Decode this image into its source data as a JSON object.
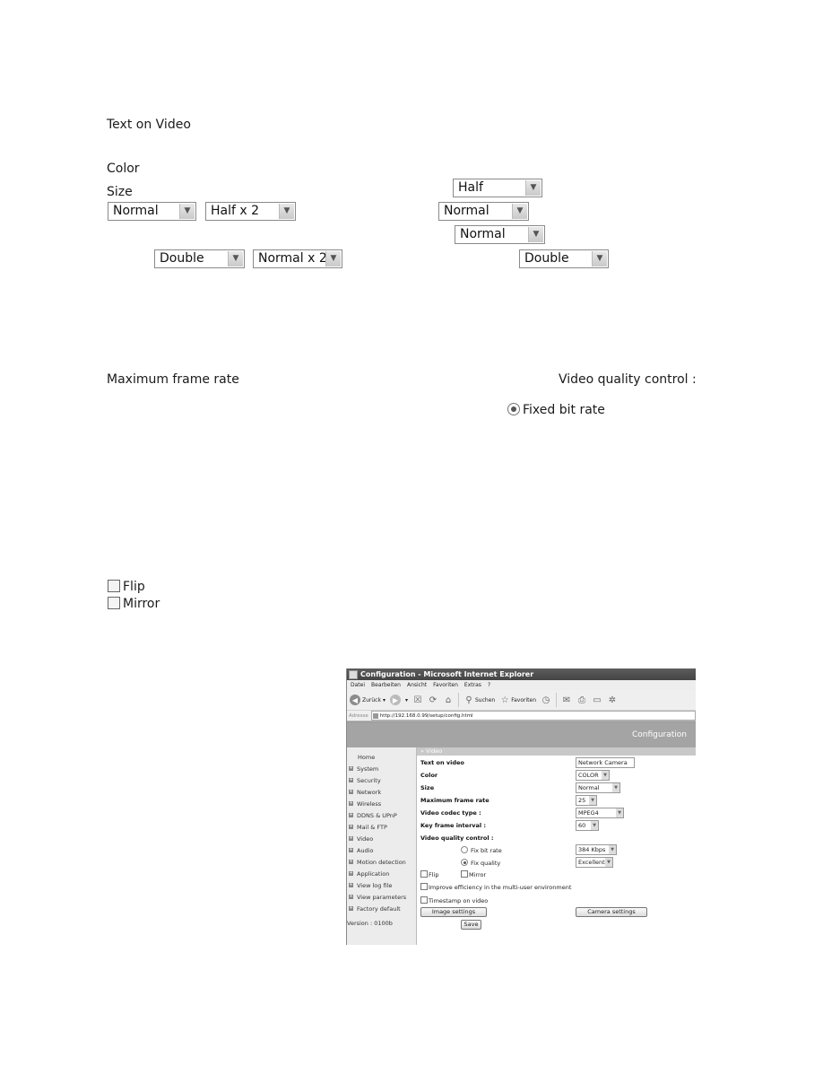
{
  "doc": {
    "text_on_video_label": "Text on Video",
    "color_label": "Color",
    "size_label": "Size",
    "size_dropdowns_left": [
      {
        "value": "Normal"
      },
      {
        "value": "Half x 2"
      },
      {
        "value": "Double"
      },
      {
        "value": "Normal x 2"
      }
    ],
    "size_dropdowns_right": [
      {
        "value": "Half"
      },
      {
        "value": "Normal"
      },
      {
        "value": "Normal"
      },
      {
        "value": "Double"
      }
    ],
    "max_frame_rate_label": "Maximum frame rate",
    "video_quality_label": "Video quality control :",
    "fixed_bit_rate_label": "Fixed bit rate",
    "fixed_bit_rate_selected": true,
    "flip_label": "Flip",
    "flip_checked": false,
    "mirror_label": "Mirror",
    "mirror_checked": false
  },
  "browser": {
    "title": "Configuration - Microsoft Internet Explorer",
    "menu": [
      "Datei",
      "Bearbeiten",
      "Ansicht",
      "Favoriten",
      "Extras",
      "?"
    ],
    "toolbar": {
      "back_label": "Zurück",
      "search_label": "Suchen",
      "favorites_label": "Favoriten"
    },
    "address_label": "Adresse",
    "url": "http://192.168.0.99/setup/config.html",
    "banner_title": "Configuration",
    "sidebar": {
      "items": [
        {
          "label": "Home",
          "expandable": false
        },
        {
          "label": "System",
          "expandable": true
        },
        {
          "label": "Security",
          "expandable": true
        },
        {
          "label": "Network",
          "expandable": true
        },
        {
          "label": "Wireless",
          "expandable": true
        },
        {
          "label": "DDNS & UPnP",
          "expandable": true
        },
        {
          "label": "Mail & FTP",
          "expandable": true
        },
        {
          "label": "Video",
          "expandable": true
        },
        {
          "label": "Audio",
          "expandable": true
        },
        {
          "label": "Motion detection",
          "expandable": true
        },
        {
          "label": "Application",
          "expandable": true
        },
        {
          "label": "View log file",
          "expandable": true
        },
        {
          "label": "View parameters",
          "expandable": true
        },
        {
          "label": "Factory default",
          "expandable": true
        }
      ],
      "version": "Version : 0100b"
    },
    "breadcrumb": "» Video",
    "form": {
      "text_on_video_label": "Text on video",
      "text_on_video_value": "Network Camera",
      "color_label": "Color",
      "color_value": "COLOR",
      "size_label": "Size",
      "size_value": "Normal",
      "max_frame_rate_label": "Maximum frame rate",
      "max_frame_rate_value": "25",
      "codec_label": "Video codec type :",
      "codec_value": "MPEG4",
      "key_frame_label": "Key frame interval :",
      "key_frame_value": "60",
      "quality_control_label": "Video quality control :",
      "fix_bit_rate_label": "Fix bit rate",
      "fix_bit_rate_value": "384 Kbps",
      "fix_bit_rate_selected": false,
      "fix_quality_label": "Fix quality",
      "fix_quality_value": "Excellent",
      "fix_quality_selected": true,
      "flip_label": "Flip",
      "mirror_label": "Mirror",
      "improve_label": "Improve efficiency in the multi-user environment",
      "timestamp_label": "Timestamp on video",
      "image_settings_label": "Image settings",
      "camera_settings_label": "Camera settings",
      "save_label": "Save"
    }
  }
}
